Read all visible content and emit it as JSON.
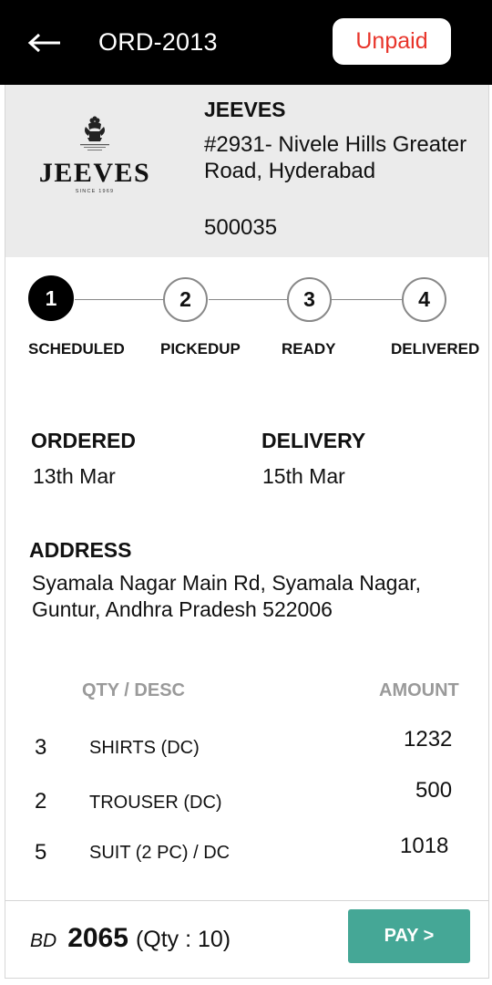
{
  "header": {
    "order_id": "ORD-2013",
    "payment_status": "Unpaid",
    "status_color": "#e8342a"
  },
  "vendor": {
    "logo_icon": "jeeves-logo",
    "name": "JEEVES",
    "address": "#2931- Nivele Hills Greater Road, Hyderabad",
    "pincode": "500035"
  },
  "progress": {
    "current_step": 1,
    "steps": [
      {
        "number": "1",
        "label": "SCHEDULED"
      },
      {
        "number": "2",
        "label": "PICKEDUP"
      },
      {
        "number": "3",
        "label": "READY"
      },
      {
        "number": "4",
        "label": "DELIVERED"
      }
    ]
  },
  "dates": {
    "ordered_label": "ORDERED",
    "ordered_value": "13th Mar",
    "delivery_label": "DELIVERY",
    "delivery_value": "15th Mar"
  },
  "address": {
    "label": "ADDRESS",
    "line1": "Syamala Nagar Main Rd, Syamala Nagar,",
    "line2": "Guntur, Andhra Pradesh 522006"
  },
  "items": {
    "header_desc": "QTY / DESC",
    "header_amount": "AMOUNT",
    "rows": [
      {
        "qty": "3",
        "desc": "SHIRTS (DC)",
        "amount": "1232"
      },
      {
        "qty": "2",
        "desc": "TROUSER (DC)",
        "amount": "500"
      },
      {
        "qty": "5",
        "desc": "SUIT (2 PC)  / DC",
        "amount": "1018"
      }
    ]
  },
  "footer": {
    "currency": "BD",
    "total": "2065",
    "qty_summary": "(Qty : 10)",
    "pay_label": "PAY >",
    "pay_color": "#45a796"
  }
}
